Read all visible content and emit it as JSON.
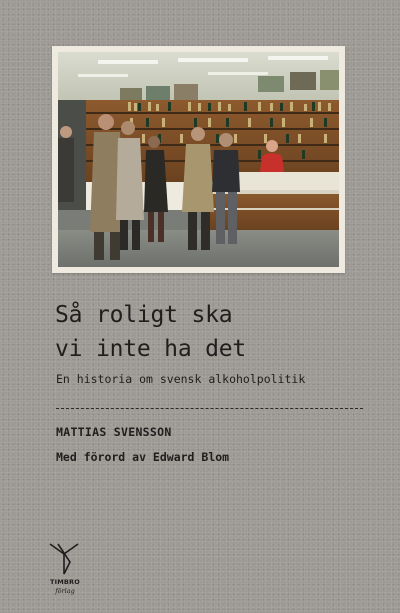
{
  "book": {
    "title_line1": "Så roligt ska",
    "title_line2": "vi inte ha det",
    "subtitle": "En historia om svensk alkoholpolitik",
    "author": "MATTIAS SVENSSON",
    "foreword": "Med förord av Edward Blom"
  },
  "publisher": {
    "name": "TIMBRO",
    "sub": "förlag",
    "logo_icon": "timbro-logo-icon"
  },
  "photo": {
    "subject": "customers queuing at a liquor store counter",
    "icon": "photo-icon"
  },
  "colors": {
    "background": "#9d9994",
    "text": "#1f1e1d",
    "frame": "#efeadf"
  }
}
